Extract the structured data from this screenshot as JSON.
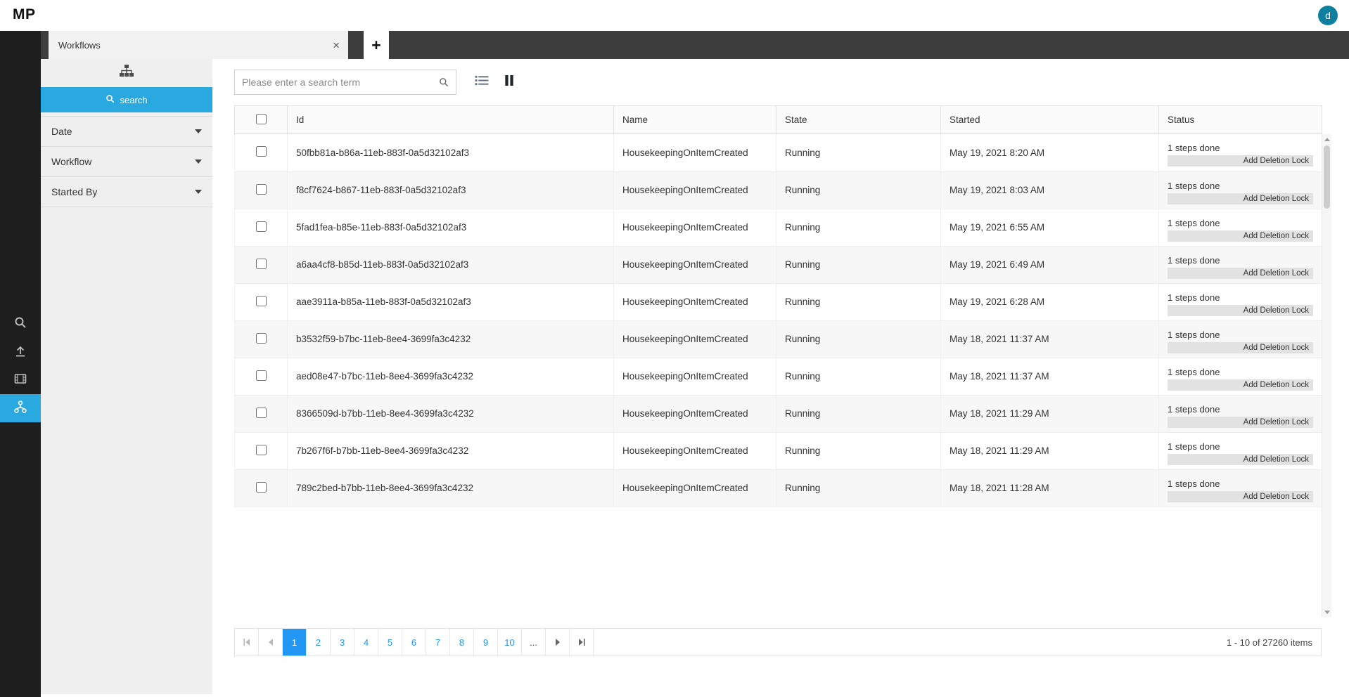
{
  "colors": {
    "accent_cyan": "#29a9e0",
    "accent_blue": "#2196f3",
    "rail_bg": "#1e1e1e",
    "tabstrip_bg": "#3d3d3d",
    "panel_bg": "#efefef",
    "avatar_bg": "#0f7f9f"
  },
  "topbar": {
    "logo": "MP",
    "avatar_initial": "d"
  },
  "tabstrip": {
    "tab_label": "Workflows",
    "close_glyph": "×",
    "add_glyph": "+"
  },
  "filter_panel": {
    "search_button_label": "search",
    "sections": [
      {
        "label": "Date"
      },
      {
        "label": "Workflow"
      },
      {
        "label": "Started By"
      }
    ]
  },
  "toolbar": {
    "search_placeholder": "Please enter a search term"
  },
  "grid": {
    "columns": [
      "Id",
      "Name",
      "State",
      "Started",
      "Status"
    ],
    "rows": [
      {
        "id": "50fbb81a-b86a-11eb-883f-0a5d32102af3",
        "name": "HousekeepingOnItemCreated",
        "state": "Running",
        "started": "May 19, 2021 8:20 AM",
        "steps": "1 steps done",
        "action": "Add Deletion Lock"
      },
      {
        "id": "f8cf7624-b867-11eb-883f-0a5d32102af3",
        "name": "HousekeepingOnItemCreated",
        "state": "Running",
        "started": "May 19, 2021 8:03 AM",
        "steps": "1 steps done",
        "action": "Add Deletion Lock"
      },
      {
        "id": "5fad1fea-b85e-11eb-883f-0a5d32102af3",
        "name": "HousekeepingOnItemCreated",
        "state": "Running",
        "started": "May 19, 2021 6:55 AM",
        "steps": "1 steps done",
        "action": "Add Deletion Lock"
      },
      {
        "id": "a6aa4cf8-b85d-11eb-883f-0a5d32102af3",
        "name": "HousekeepingOnItemCreated",
        "state": "Running",
        "started": "May 19, 2021 6:49 AM",
        "steps": "1 steps done",
        "action": "Add Deletion Lock"
      },
      {
        "id": "aae3911a-b85a-11eb-883f-0a5d32102af3",
        "name": "HousekeepingOnItemCreated",
        "state": "Running",
        "started": "May 19, 2021 6:28 AM",
        "steps": "1 steps done",
        "action": "Add Deletion Lock"
      },
      {
        "id": "b3532f59-b7bc-11eb-8ee4-3699fa3c4232",
        "name": "HousekeepingOnItemCreated",
        "state": "Running",
        "started": "May 18, 2021 11:37 AM",
        "steps": "1 steps done",
        "action": "Add Deletion Lock"
      },
      {
        "id": "aed08e47-b7bc-11eb-8ee4-3699fa3c4232",
        "name": "HousekeepingOnItemCreated",
        "state": "Running",
        "started": "May 18, 2021 11:37 AM",
        "steps": "1 steps done",
        "action": "Add Deletion Lock"
      },
      {
        "id": "8366509d-b7bb-11eb-8ee4-3699fa3c4232",
        "name": "HousekeepingOnItemCreated",
        "state": "Running",
        "started": "May 18, 2021 11:29 AM",
        "steps": "1 steps done",
        "action": "Add Deletion Lock"
      },
      {
        "id": "7b267f6f-b7bb-11eb-8ee4-3699fa3c4232",
        "name": "HousekeepingOnItemCreated",
        "state": "Running",
        "started": "May 18, 2021 11:29 AM",
        "steps": "1 steps done",
        "action": "Add Deletion Lock"
      },
      {
        "id": "789c2bed-b7bb-11eb-8ee4-3699fa3c4232",
        "name": "HousekeepingOnItemCreated",
        "state": "Running",
        "started": "May 18, 2021 11:28 AM",
        "steps": "1 steps done",
        "action": "Add Deletion Lock"
      }
    ]
  },
  "pager": {
    "pages": [
      "1",
      "2",
      "3",
      "4",
      "5",
      "6",
      "7",
      "8",
      "9",
      "10"
    ],
    "active_page": "1",
    "ellipsis": "...",
    "summary": "1 - 10 of 27260 items"
  }
}
